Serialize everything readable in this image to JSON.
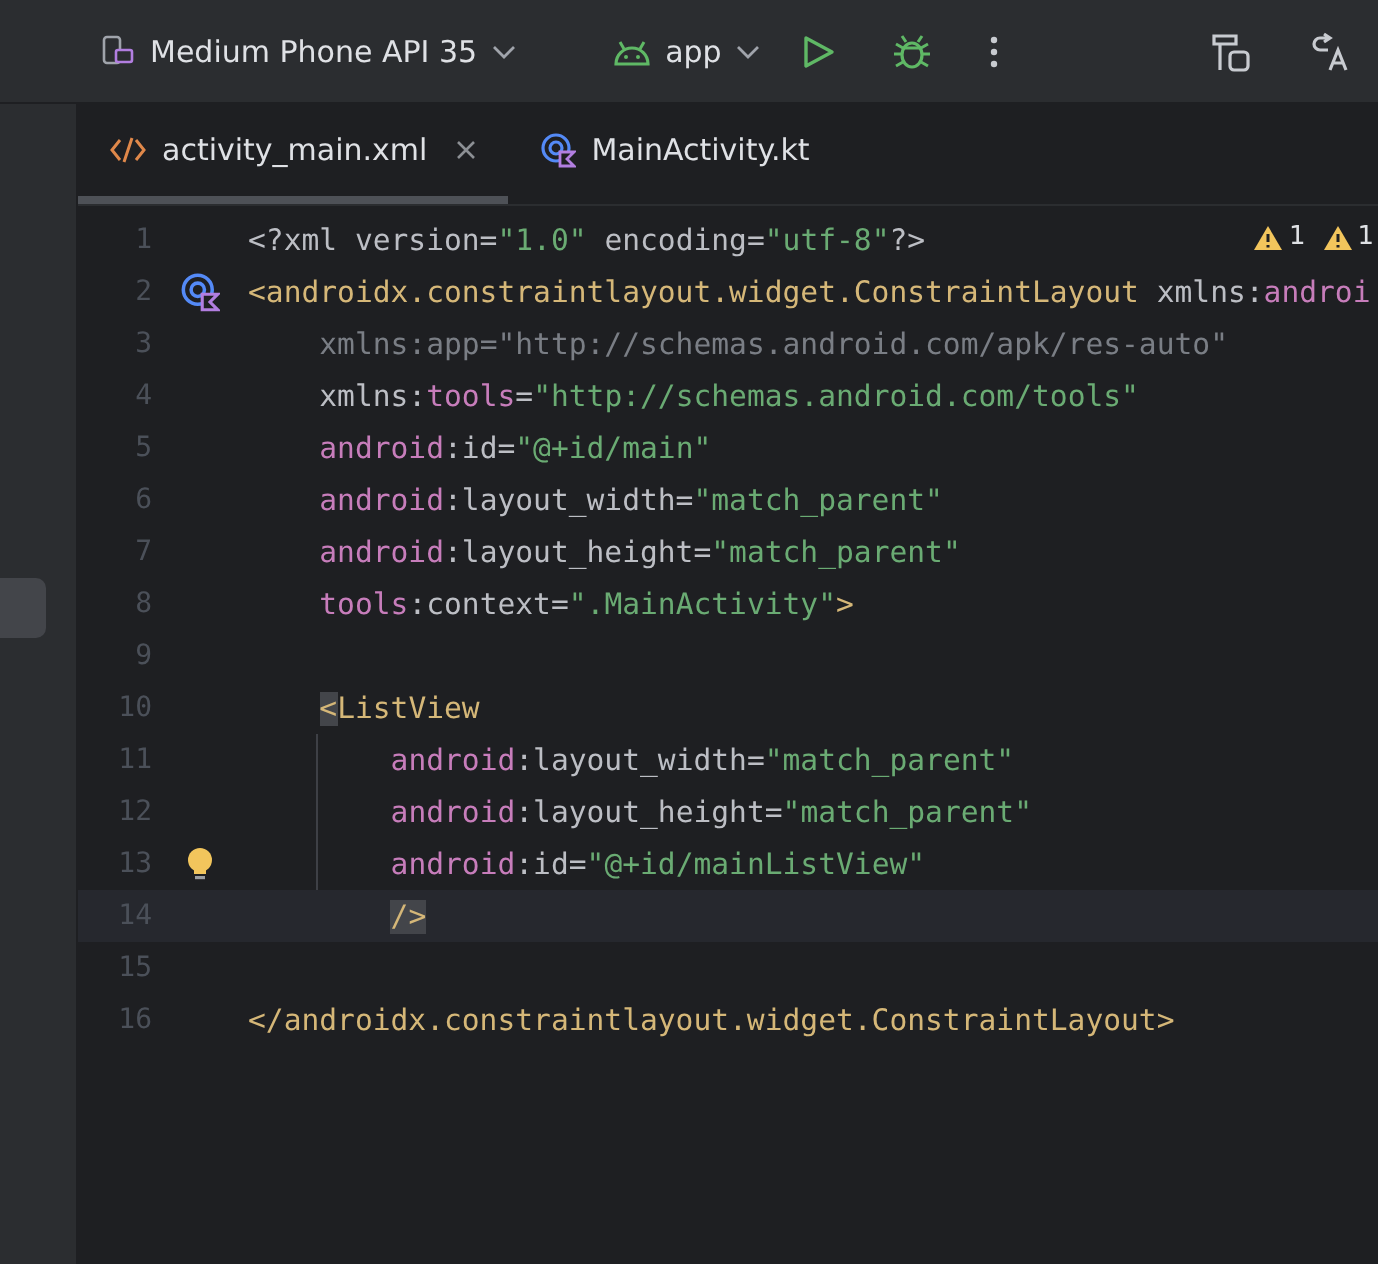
{
  "toolbar": {
    "device": "Medium Phone API 35",
    "module": "app"
  },
  "tabs": [
    {
      "label": "activity_main.xml",
      "kind": "xml",
      "selected": true,
      "closable": true
    },
    {
      "label": "MainActivity.kt",
      "kind": "kotlin",
      "selected": false,
      "closable": false
    }
  ],
  "warnings": [
    {
      "count": "1"
    },
    {
      "count": "1"
    }
  ],
  "lines": [
    {
      "number": "1",
      "current": false,
      "kind": "plain",
      "tokens": [
        {
          "kind": "plain",
          "text": "<?xml version="
        },
        {
          "kind": "string",
          "text": "\"1.0\""
        },
        {
          "kind": "plain",
          "text": " encoding="
        },
        {
          "kind": "string",
          "text": "\"utf-8\""
        },
        {
          "kind": "plain",
          "text": "?>"
        }
      ]
    },
    {
      "number": "2",
      "current": false,
      "kind": "class_marker",
      "tokens": [
        {
          "kind": "tag",
          "text": "<androidx.constraintlayout.widget.ConstraintLayout "
        },
        {
          "kind": "plain",
          "text": "xmlns:"
        },
        {
          "kind": "ns",
          "text": "androi"
        }
      ]
    },
    {
      "number": "3",
      "current": false,
      "kind": "plain",
      "tokens": [
        {
          "kind": "unused",
          "text": "    xmlns:app=\"http://schemas.android.com/apk/res-auto\""
        }
      ]
    },
    {
      "number": "4",
      "current": false,
      "kind": "plain",
      "tokens": [
        {
          "kind": "plain",
          "text": "    xmlns:"
        },
        {
          "kind": "ns",
          "text": "tools"
        },
        {
          "kind": "plain",
          "text": "="
        },
        {
          "kind": "string",
          "text": "\"http://schemas.android.com/tools\""
        }
      ]
    },
    {
      "number": "5",
      "current": false,
      "kind": "plain",
      "tokens": [
        {
          "kind": "ns",
          "text": "    android"
        },
        {
          "kind": "plain",
          "text": ":id="
        },
        {
          "kind": "string",
          "text": "\"@+id/main\""
        }
      ]
    },
    {
      "number": "6",
      "current": false,
      "kind": "plain",
      "tokens": [
        {
          "kind": "ns",
          "text": "    android"
        },
        {
          "kind": "plain",
          "text": ":layout_width="
        },
        {
          "kind": "string",
          "text": "\"match_parent\""
        }
      ]
    },
    {
      "number": "7",
      "current": false,
      "kind": "plain",
      "tokens": [
        {
          "kind": "ns",
          "text": "    android"
        },
        {
          "kind": "plain",
          "text": ":layout_height="
        },
        {
          "kind": "string",
          "text": "\"match_parent\""
        }
      ]
    },
    {
      "number": "8",
      "current": false,
      "kind": "plain",
      "tokens": [
        {
          "kind": "ns",
          "text": "    tools"
        },
        {
          "kind": "plain",
          "text": ":context="
        },
        {
          "kind": "string",
          "text": "\".MainActivity\""
        },
        {
          "kind": "tag",
          "text": ">"
        }
      ]
    },
    {
      "number": "9",
      "current": false,
      "kind": "plain"
    },
    {
      "number": "10",
      "current": false,
      "kind": "plain",
      "tokens": [
        {
          "kind": "matched",
          "text": "    <"
        },
        {
          "kind": "tag",
          "text": "ListView"
        }
      ]
    },
    {
      "number": "11",
      "current": false,
      "kind": "plain",
      "tokens": [
        {
          "kind": "ns",
          "text": "        android"
        },
        {
          "kind": "plain",
          "text": ":layout_width="
        },
        {
          "kind": "string",
          "text": "\"match_parent\""
        }
      ]
    },
    {
      "number": "12",
      "current": false,
      "kind": "plain",
      "tokens": [
        {
          "kind": "ns",
          "text": "        android"
        },
        {
          "kind": "plain",
          "text": ":layout_height="
        },
        {
          "kind": "string",
          "text": "\"match_parent\""
        }
      ]
    },
    {
      "number": "13",
      "current": false,
      "kind": "bulb",
      "tokens": [
        {
          "kind": "ns",
          "text": "        android"
        },
        {
          "kind": "plain",
          "text": ":id="
        },
        {
          "kind": "string",
          "text": "\"@+id/mainListView\""
        }
      ]
    },
    {
      "number": "14",
      "current": true,
      "kind": "plain",
      "tokens": [
        {
          "kind": "matched",
          "text": "        />"
        }
      ]
    },
    {
      "number": "15",
      "current": false,
      "kind": "plain"
    },
    {
      "number": "16",
      "current": false,
      "kind": "plain",
      "tokens": [
        {
          "kind": "tag",
          "text": "</androidx.constraintlayout.widget.ConstraintLayout>"
        }
      ]
    }
  ]
}
